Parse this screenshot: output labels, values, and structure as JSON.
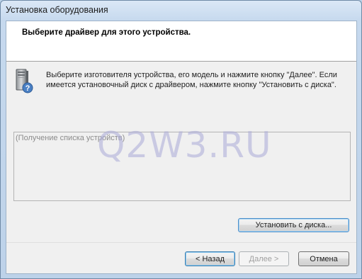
{
  "window": {
    "title": "Установка оборудования"
  },
  "header": {
    "title": "Выберите драйвер для этого устройства."
  },
  "instruction": {
    "line1": "Выберите изготовителя устройства, его модель и нажмите кнопку \"Далее\". Если",
    "line2": "имеется установочный диск с  драйвером, нажмите кнопку \"Установить с диска\"."
  },
  "device_list": {
    "status_text": "(Получение списка устройств)"
  },
  "watermark": {
    "text": "Q2W3.RU"
  },
  "buttons": {
    "have_disk": "Установить с диска...",
    "back": "< Назад",
    "next": "Далее >",
    "cancel": "Отмена"
  },
  "icons": {
    "hardware": "computer-tower-with-question-mark-icon"
  },
  "colors": {
    "header_bg": "#ffffff",
    "dialog_bg": "#f0f0f0",
    "frame": "#bcd3ea",
    "disabled_text": "#a0a0a0",
    "focus_border": "#3c7fb1"
  }
}
